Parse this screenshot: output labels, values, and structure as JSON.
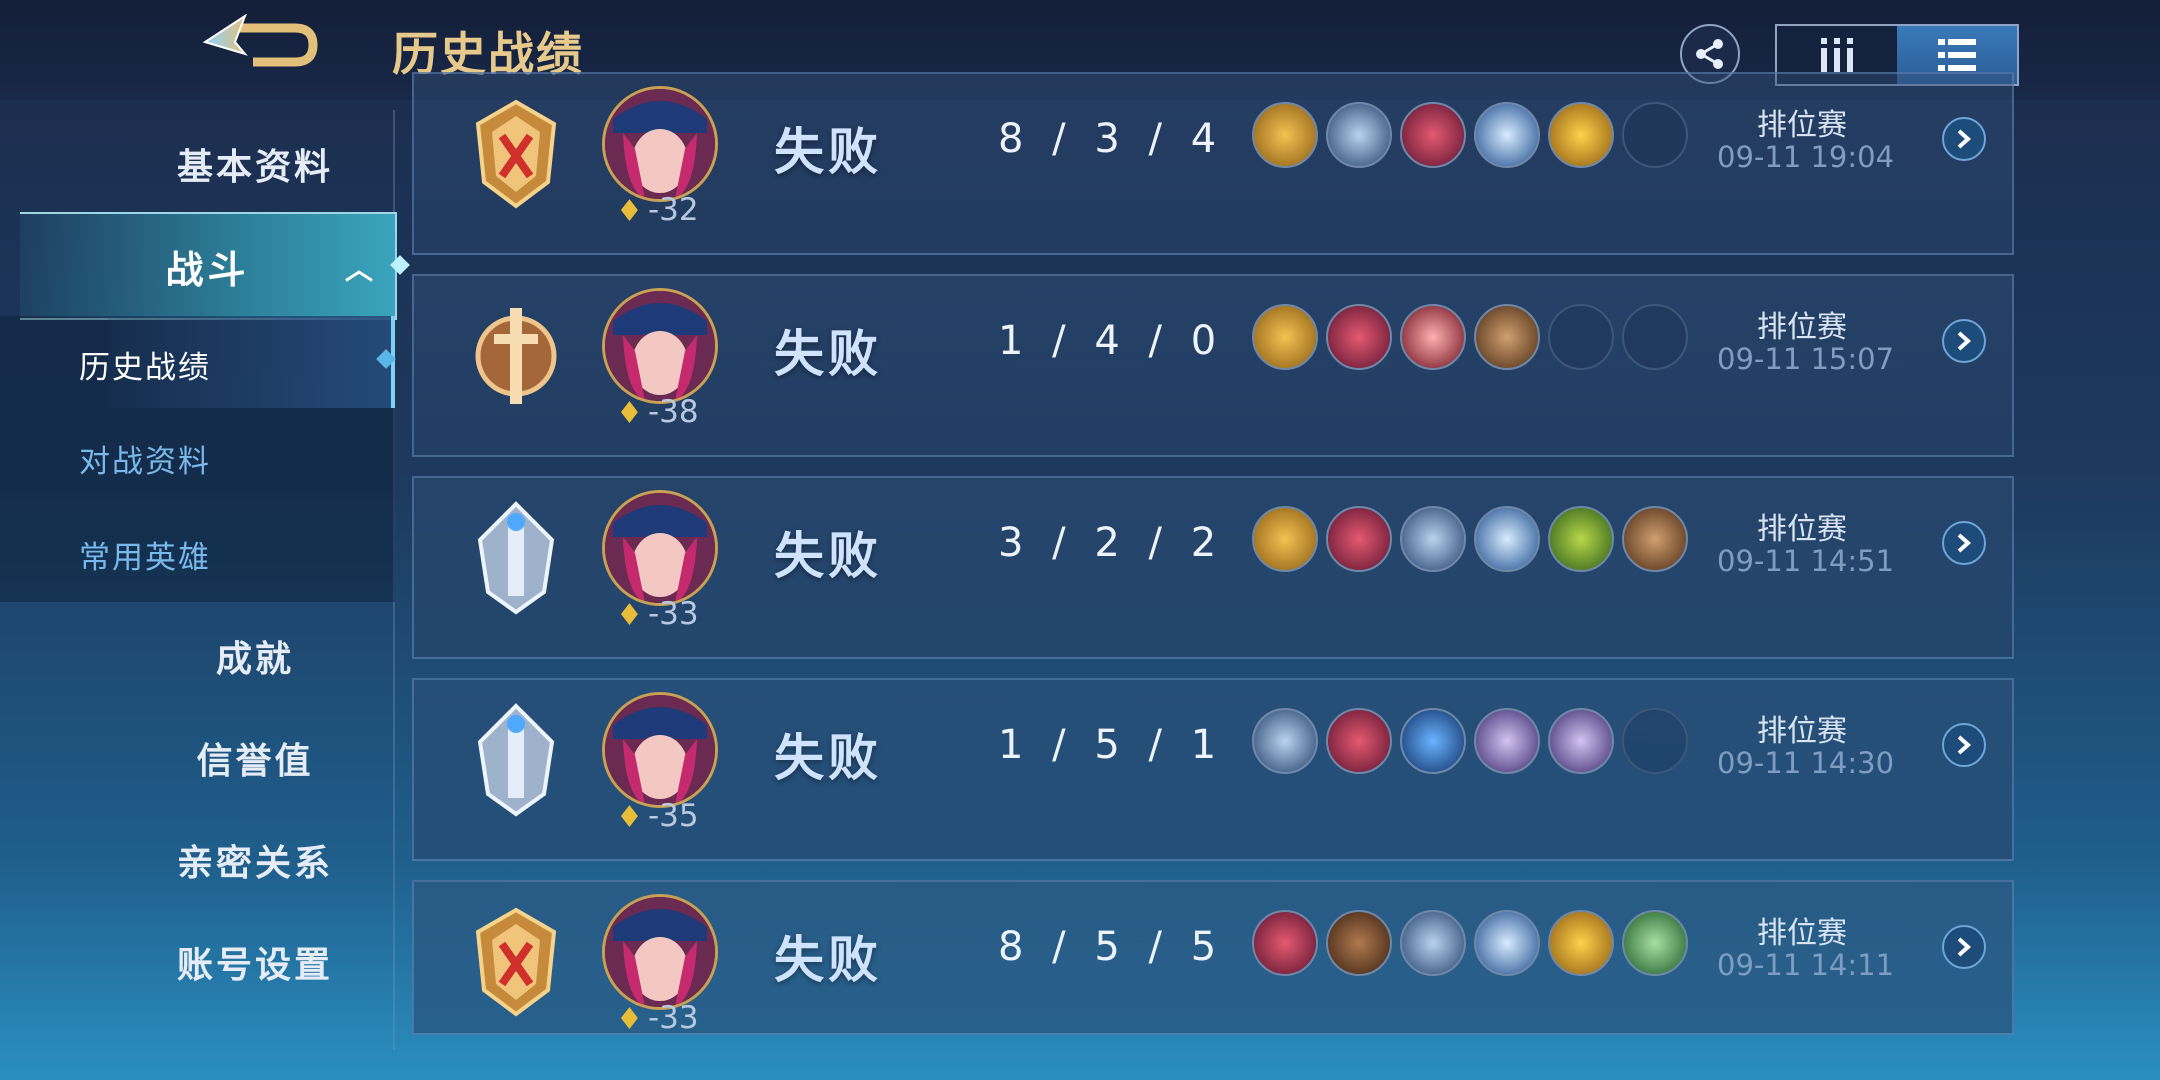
{
  "header": {
    "title": "历史战绩"
  },
  "sidebar": {
    "items": [
      {
        "label": "基本资料"
      },
      {
        "label": "战斗"
      },
      {
        "label": "成就"
      },
      {
        "label": "信誉值"
      },
      {
        "label": "亲密关系"
      },
      {
        "label": "账号设置"
      }
    ],
    "sub_items": [
      {
        "label": "历史战绩"
      },
      {
        "label": "对战资料"
      },
      {
        "label": "常用英雄"
      }
    ]
  },
  "matches": [
    {
      "result": "失败",
      "kda": "8 / 3 / 4",
      "score": "-32",
      "mode": "排位赛",
      "time": "09-11 19:04",
      "rank_icon": "gold-crossed-badge-icon"
    },
    {
      "result": "失败",
      "kda": "1 / 4 / 0",
      "score": "-38",
      "mode": "排位赛",
      "time": "09-11 15:07",
      "rank_icon": "bronze-sword-badge-icon"
    },
    {
      "result": "失败",
      "kda": "3 / 2 / 2",
      "score": "-33",
      "mode": "排位赛",
      "time": "09-11 14:51",
      "rank_icon": "silver-badge-icon"
    },
    {
      "result": "失败",
      "kda": "1 / 5 / 1",
      "score": "-35",
      "mode": "排位赛",
      "time": "09-11 14:30",
      "rank_icon": "silver-badge-icon"
    },
    {
      "result": "失败",
      "kda": "8 / 5 / 5",
      "score": "-33",
      "mode": "排位赛",
      "time": "09-11 14:11",
      "rank_icon": "gold-crossed-badge-icon"
    }
  ],
  "colors": {
    "accent_gold": "#e8c98c",
    "result_blue": "#cfe3ff",
    "time_blue": "#7f9cc1"
  }
}
